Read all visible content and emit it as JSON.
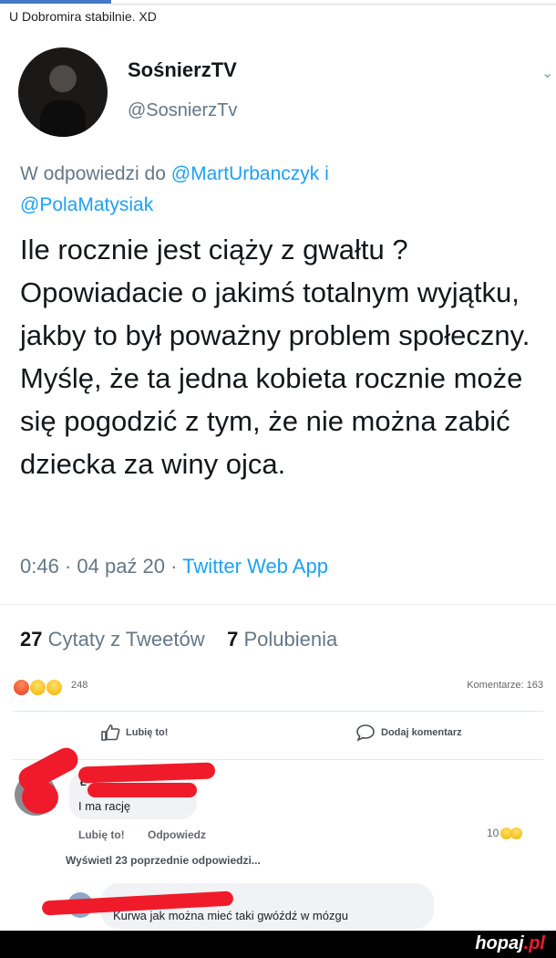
{
  "post": {
    "caption": "U Dobromira stabilnie. XD"
  },
  "tweet": {
    "display_name": "SośnierzTV",
    "handle": "@SosnierzTv",
    "replying_prefix": "W odpowiedzi do",
    "mention_1": "@MartUrbanczyk",
    "replying_joiner": "i",
    "mention_2": "@PolaMatysiak",
    "text": "Ile rocznie jest ciąży z gwałtu ? Opowiadacie o jakimś totalnym wyjątku, jakby to był poważny problem społeczny. Myślę, że ta jedna kobieta rocznie może się pogodzić z tym, że nie można zabić dziecka za winy ojca.",
    "time": "0:46 · 04 paź 20 ·",
    "source": "Twitter Web App",
    "quotes_count": "27",
    "quotes_label": "Cytaty z Tweetów",
    "likes_count": "7",
    "likes_label": "Polubienia"
  },
  "facebook": {
    "reactions_count": "248",
    "comments_count_label": "Komentarze: 163",
    "like_label": "Lubię to!",
    "comment_label": "Dodaj komentarz",
    "reaction_icons": [
      "angry-emoji",
      "haha-emoji",
      "sad-emoji"
    ]
  },
  "comments": [
    {
      "name_visible": "Ł",
      "text": "I ma rację",
      "like": "Lubię to!",
      "reply": "Odpowiedz",
      "reactions": "10"
    },
    {
      "text": "Kurwa jak można mieć taki gwóźdź w mózgu"
    }
  ],
  "more_replies": "Wyświetl 23 poprzednie odpowiedzi...",
  "watermark": {
    "site": "hopaj",
    "tld": ".pl"
  },
  "colors": {
    "twitter_blue": "#1da1f2",
    "redaction_red": "#ef1b2b",
    "facebook_gray": "#f0f2f5"
  }
}
